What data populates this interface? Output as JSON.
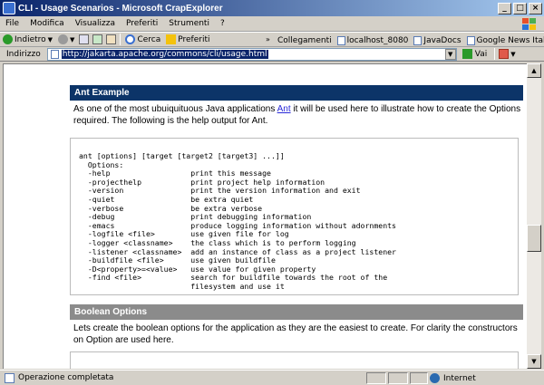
{
  "window": {
    "title": "CLI - Usage Scenarios - Microsoft CrapExplorer"
  },
  "menu": [
    "File",
    "Modifica",
    "Visualizza",
    "Preferiti",
    "Strumenti",
    "?"
  ],
  "toolbar": {
    "back_label": "Indietro",
    "search_label": "Cerca",
    "favorites_label": "Preferiti"
  },
  "links": {
    "label": "Collegamenti",
    "items": [
      "localhost_8080",
      "JavaDocs",
      "Google News Italia"
    ]
  },
  "address": {
    "label": "Indirizzo",
    "url": "http://jakarta.apache.org/commons/cli/usage.html",
    "go_label": "Vai"
  },
  "page": {
    "ant_heading": "Ant Example",
    "ant_intro_before": "As one of the most ubuiquituous Java applications ",
    "ant_link": "Ant",
    "ant_intro_after": " it will be used here to illustrate how to create the Options required. The following is the help output for Ant.",
    "code": "ant [options] [target [target2 [target3] ...]]\n  Options:\n  -help                  print this message\n  -projecthelp           print project help information\n  -version               print the version information and exit\n  -quiet                 be extra quiet\n  -verbose               be extra verbose\n  -debug                 print debugging information\n  -emacs                 produce logging information without adornments\n  -logfile <file>        use given file for log\n  -logger <classname>    the class which is to perform logging\n  -listener <classname>  add an instance of class as a project listener\n  -buildfile <file>      use given buildfile\n  -D<property>=<value>   use value for given property\n  -find <file>           search for buildfile towards the root of the\n                         filesystem and use it",
    "bool_heading": "Boolean Options",
    "bool_text": "Lets create the boolean options for the application as they are the easiest to create. For clarity the constructors on Option are used here."
  },
  "status": {
    "text": "Operazione completata",
    "zone": "Internet"
  },
  "colors": {
    "section_navy": "#0c3468",
    "section_grey": "#8b8b8b",
    "link": "#2a2ad8"
  }
}
